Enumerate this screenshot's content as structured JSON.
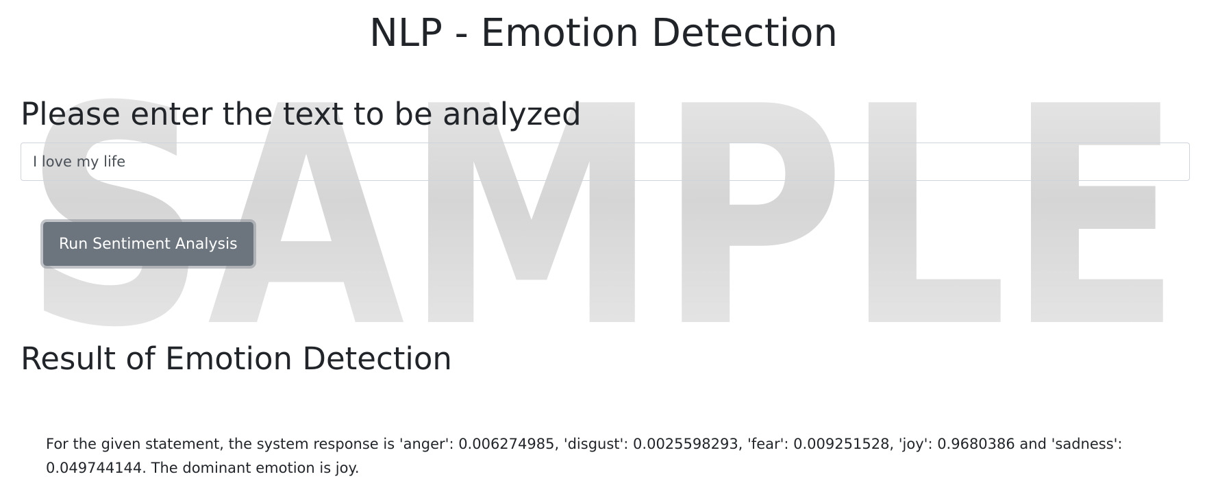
{
  "header": {
    "title": "NLP - Emotion Detection"
  },
  "form": {
    "heading": "Please enter the text to be analyzed",
    "input_value": "I love my life",
    "button_label": "Run Sentiment Analysis"
  },
  "result": {
    "heading": "Result of Emotion Detection",
    "text": "For the given statement, the system response is 'anger': 0.006274985, 'disgust': 0.0025598293, 'fear': 0.009251528, 'joy': 0.9680386 and 'sadness': 0.049744144. The dominant emotion is joy."
  },
  "watermark": {
    "text": "SAMPLE",
    "color": "#d9d9d9"
  },
  "theme": {
    "button_color": "#6c757d",
    "text_color": "#212529"
  }
}
